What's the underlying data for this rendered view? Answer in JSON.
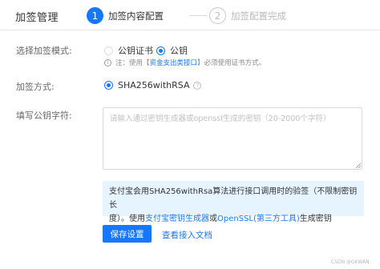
{
  "header": {
    "title": "加签管理",
    "steps": [
      {
        "number": "1",
        "label": "加签内容配置",
        "active": true
      },
      {
        "number": "2",
        "label": "加签配置完成",
        "active": false
      }
    ]
  },
  "form": {
    "sign_mode": {
      "label": "选择加签模式:",
      "options": [
        {
          "label": "公钥证书",
          "selected": false
        },
        {
          "label": "公钥",
          "selected": true
        }
      ],
      "note": {
        "prefix": "注：使用",
        "link": "资金支出类接口",
        "suffix": "必须使用证书方式。"
      }
    },
    "sign_method": {
      "label": "加签方式:",
      "option": "SHA256withRSA",
      "selected": true
    },
    "public_key": {
      "label": "填写公钥字符:",
      "value": "",
      "placeholder": "请输入通过密钥生成器或openssl生成的密钥（20-2000个字符）"
    }
  },
  "tip": {
    "line1": "支付宝会用SHA256withRsa算法进行接口调用时的验签（不限制密钥长",
    "line2_prefix": "度）。使用",
    "link1": "支付宝密钥生成器",
    "or": "或",
    "link2": "OpenSSL(第三方工具)",
    "suffix": "生成密钥"
  },
  "actions": {
    "save_label": "保存设置",
    "docs_label": "查看接入文档"
  },
  "watermark": "CSDN @GKWAN",
  "colors": {
    "accent": "#1677ff",
    "tip_background": "#e6f4ff"
  }
}
